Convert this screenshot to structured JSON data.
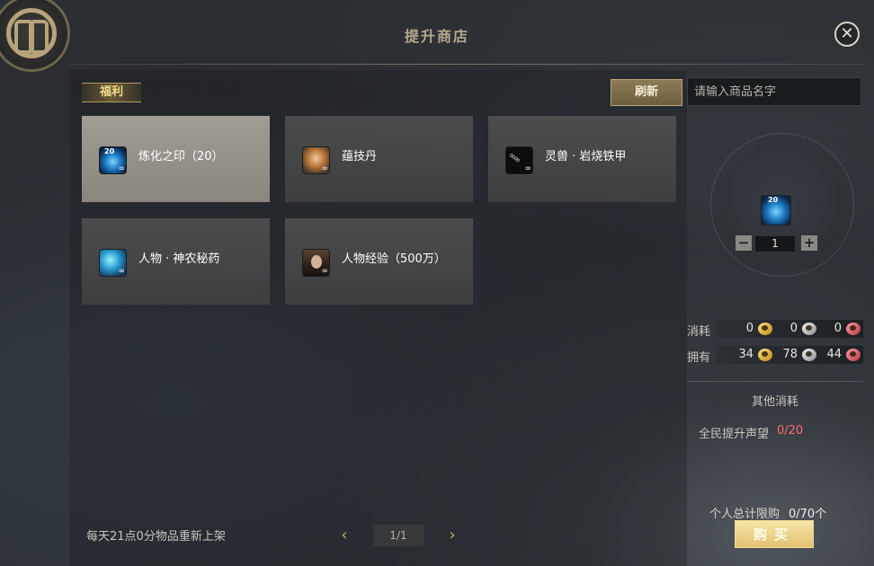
{
  "window": {
    "title": "提升商店",
    "close_icon": "✕"
  },
  "tabs": [
    {
      "label": "福利",
      "active": true
    }
  ],
  "toolbar": {
    "refresh_label": "刷新",
    "search_placeholder": "请输入商品名字"
  },
  "items": [
    {
      "name": "炼化之印（20）",
      "icon": "seal-icon",
      "badge": "20",
      "bind_mark": "∞",
      "selected": true
    },
    {
      "name": "蕴技丹",
      "icon": "pill-icon",
      "bind_mark": "∞",
      "selected": false
    },
    {
      "name": "灵兽 · 岩烧铁甲",
      "icon": "chain-icon",
      "bind_mark": "∞",
      "selected": false
    },
    {
      "name": "人物 · 神农秘药",
      "icon": "medicine-icon",
      "bind_mark": "∞",
      "selected": false
    },
    {
      "name": "人物经验（500万）",
      "icon": "portrait-icon",
      "bind_mark": "∞",
      "selected": false
    }
  ],
  "footer": {
    "notice": "每天21点0分物品重新上架",
    "page": "1/1",
    "prev_icon": "‹",
    "next_icon": "›"
  },
  "detail": {
    "badge": "20",
    "quantity": "1",
    "minus_label": "−",
    "plus_label": "+",
    "cost_label": "消耗",
    "own_label": "拥有",
    "cost": {
      "gold": "0",
      "silver": "0",
      "red": "0"
    },
    "own": {
      "gold": "34",
      "silver": "78",
      "red": "44"
    },
    "other_cost_title": "其他消耗",
    "reputation_label": "全民提升声望",
    "reputation_value": "0/20",
    "limit_label": "个人总计限购",
    "limit_value": "0/70个",
    "buy_label": "购买"
  },
  "colors": {
    "accent_gold": "#e2c170",
    "warning_red": "#ff6d6d",
    "tab_text": "#f3d98a"
  }
}
